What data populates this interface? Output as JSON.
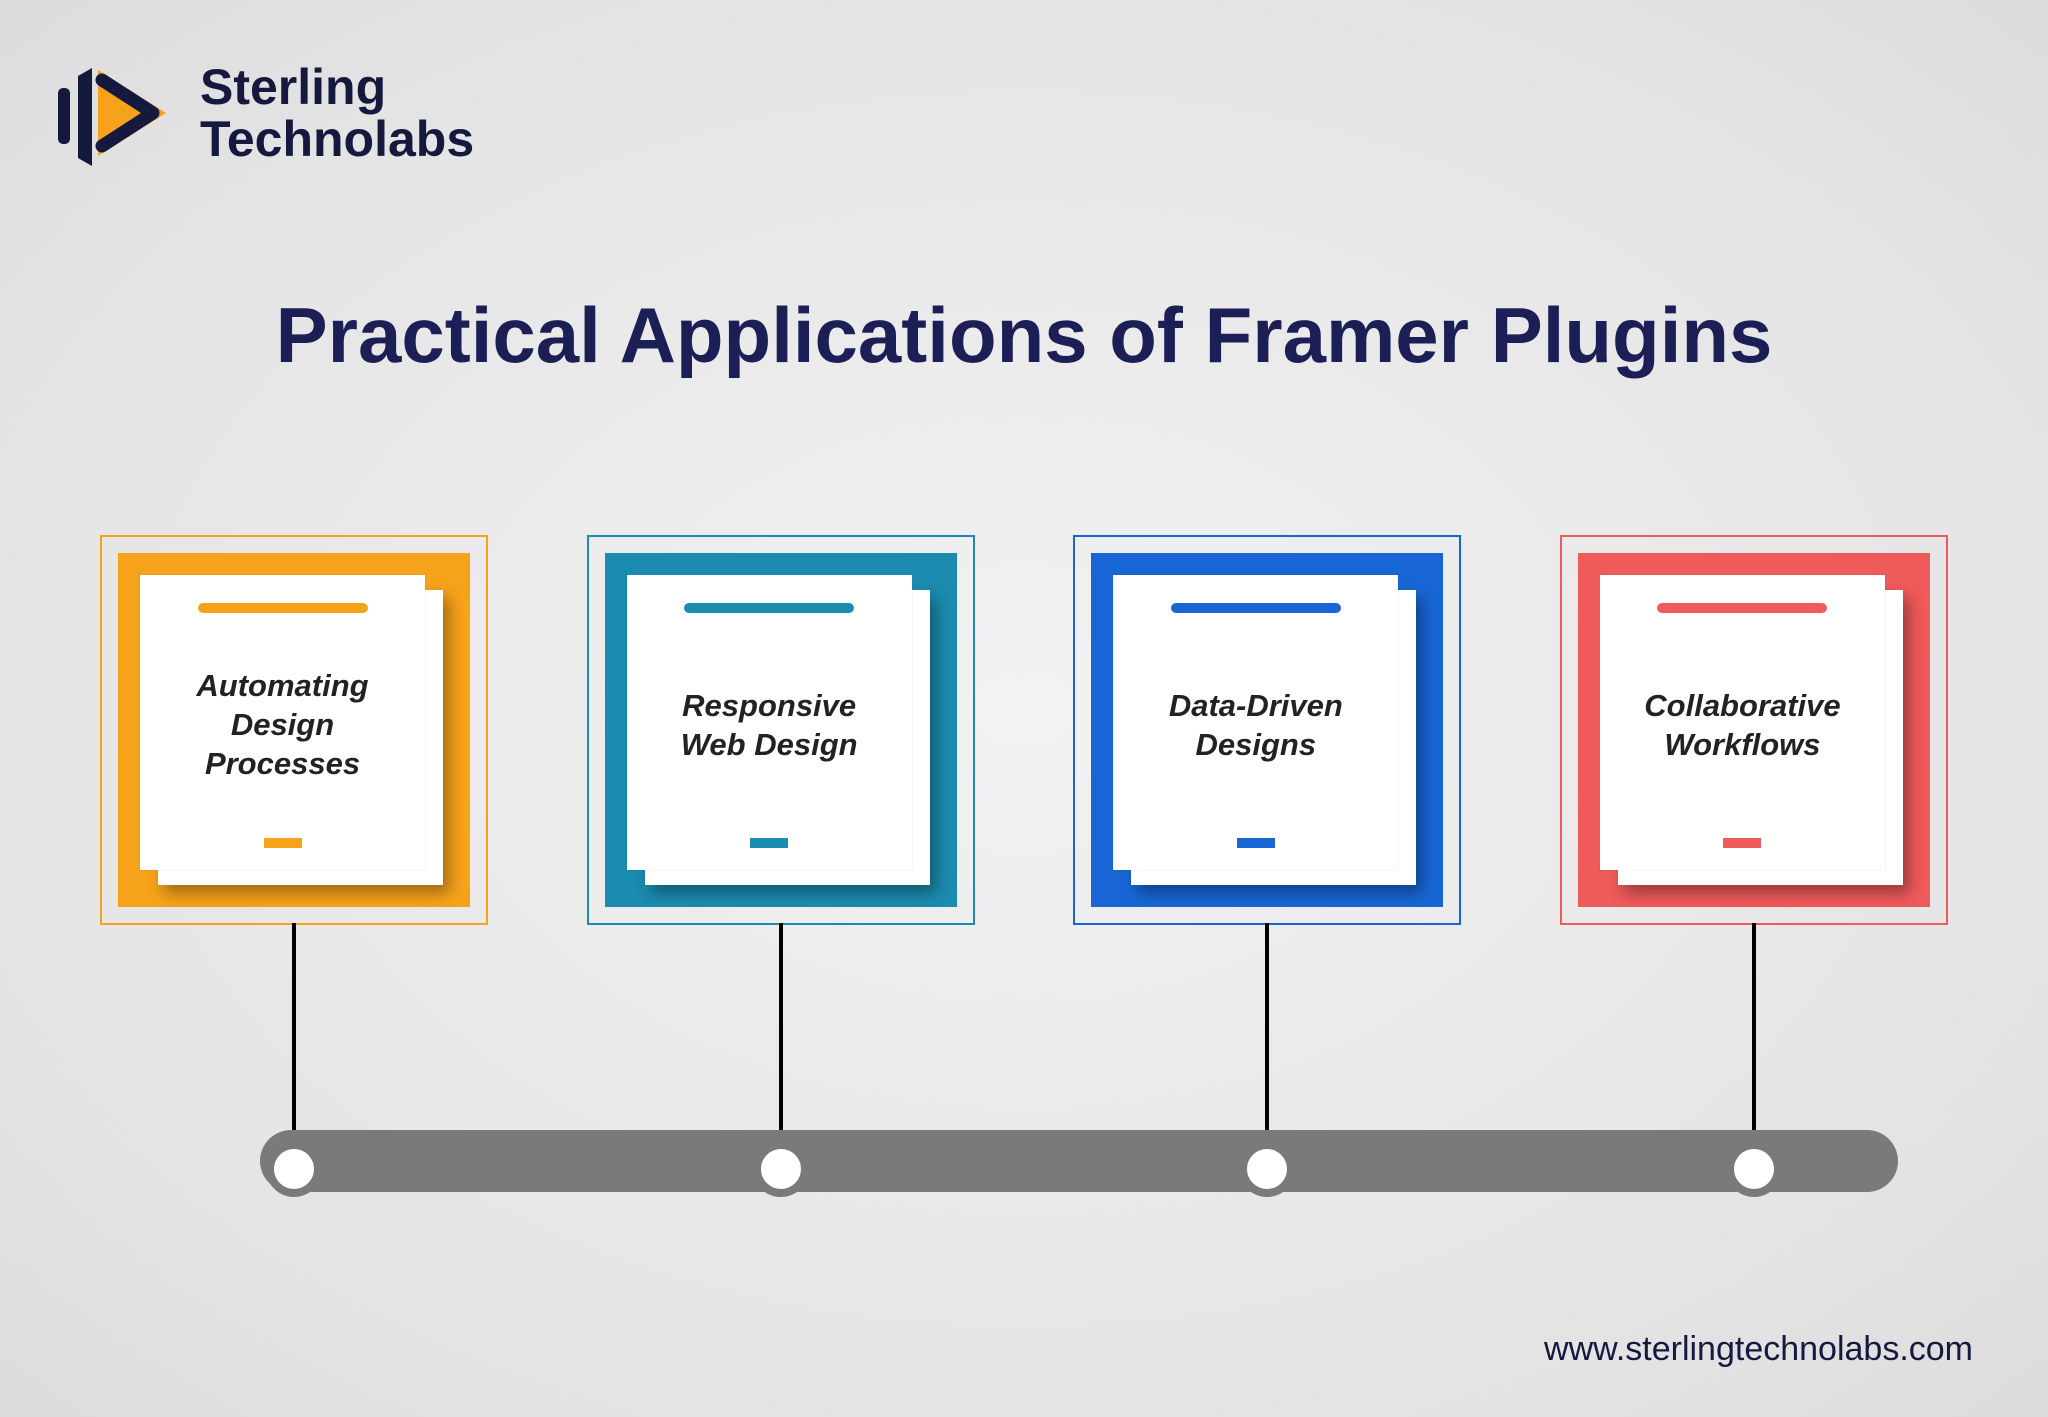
{
  "logo": {
    "line1": "Sterling",
    "line2": "Technolabs",
    "accent_color": "#f6a21b",
    "dark_color": "#16193e"
  },
  "title": "Practical Applications of Framer Plugins",
  "cards": [
    {
      "label": "Automating Design Processes",
      "color": "#f6a21b",
      "outline": "#f6a21b"
    },
    {
      "label": "Responsive Web Design",
      "color": "#1b8baf",
      "outline": "#1b8baf"
    },
    {
      "label": "Data-Driven Designs",
      "color": "#1866d6",
      "outline": "#1866d6"
    },
    {
      "label": "Collaborative Workflows",
      "color": "#ef5a5a",
      "outline": "#ef5a5a"
    }
  ],
  "footer_url": "www.sterlingtechnolabs.com"
}
